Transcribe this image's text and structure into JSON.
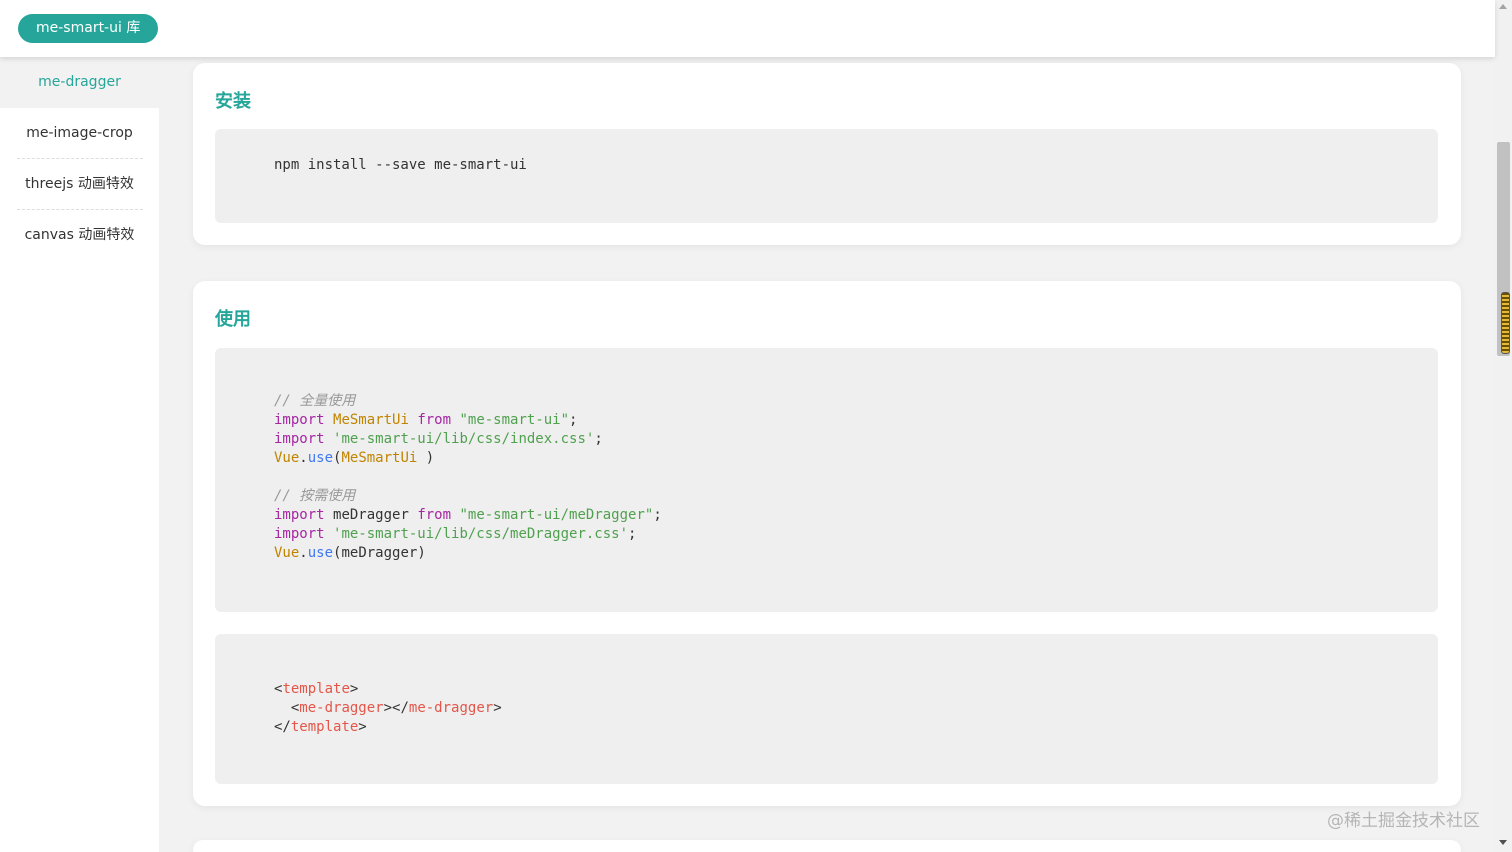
{
  "header": {
    "logo_label": "me-smart-ui 库"
  },
  "sidebar": {
    "items": [
      {
        "label": "me-dragger",
        "active": true
      },
      {
        "label": "me-image-crop",
        "active": false
      },
      {
        "label": "threejs 动画特效",
        "active": false
      },
      {
        "label": "canvas 动画特效",
        "active": false
      }
    ]
  },
  "install": {
    "title": "安装",
    "code": "npm install --save me-smart-ui"
  },
  "usage": {
    "title": "使用",
    "js": {
      "comment_full": "// 全量使用",
      "import_kw": "import",
      "from_kw": "from",
      "full_name": "MeSmartUi",
      "full_src": "\"me-smart-ui\"",
      "full_css": "'me-smart-ui/lib/css/index.css'",
      "vue": "Vue",
      "use": "use",
      "full_use_arg": "MeSmartUi ",
      "comment_partial": "// 按需使用",
      "partial_name": "meDragger",
      "partial_src": "\"me-smart-ui/meDragger\"",
      "partial_css": "'me-smart-ui/lib/css/meDragger.css'",
      "partial_use_arg": "meDragger"
    },
    "template": {
      "tag_template": "template",
      "tag_component": "me-dragger"
    }
  },
  "watermark": "@稀土掘金技术社区",
  "colors": {
    "accent": "#26a69a",
    "keyword": "#a626a4",
    "class": "#c18401",
    "string": "#50a14f",
    "function": "#4078f2",
    "tag": "#e45649",
    "comment": "#999999"
  }
}
